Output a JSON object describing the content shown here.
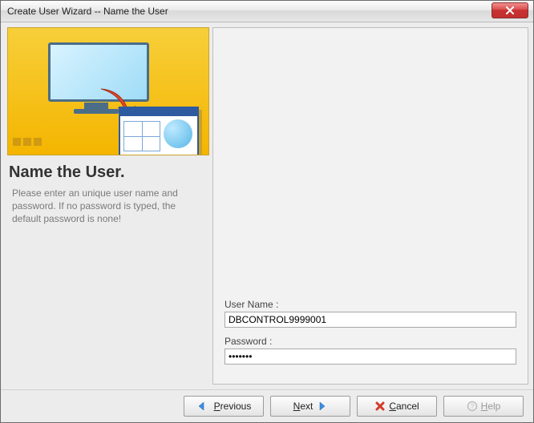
{
  "window": {
    "title": "Create User Wizard -- Name the User"
  },
  "sidebar": {
    "heading": "Name the User.",
    "description": "Please enter an unique user name and password. If no password is typed, the default password is none!"
  },
  "form": {
    "username_label": "User Name :",
    "username_value": "DBCONTROL9999001",
    "password_label": "Password :",
    "password_value": "•••••••"
  },
  "buttons": {
    "previous": "Previous",
    "next": "Next",
    "cancel": "Cancel",
    "help": "Help"
  }
}
